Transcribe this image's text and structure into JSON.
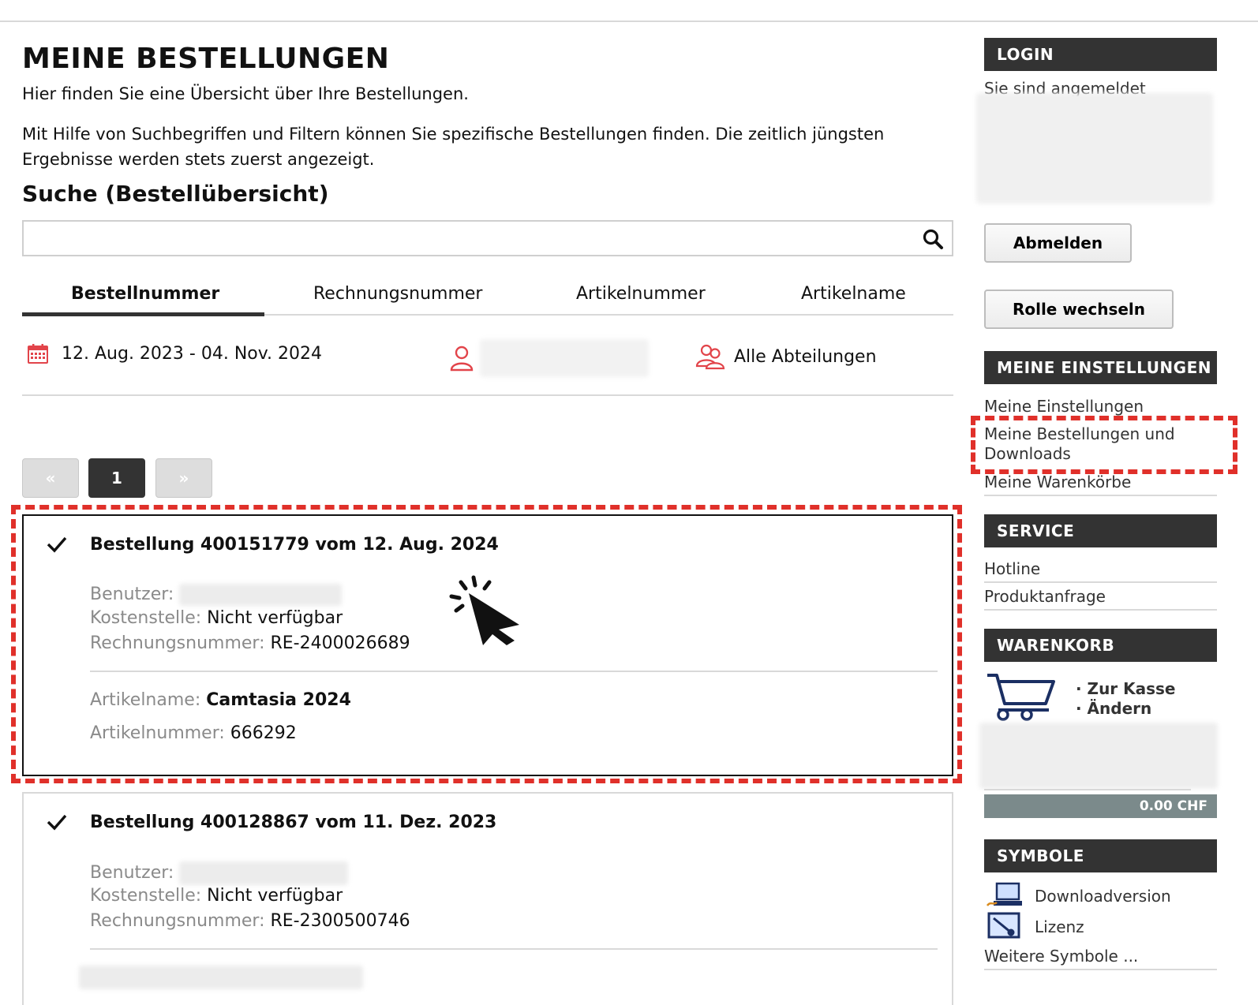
{
  "page": {
    "title": "MEINE BESTELLUNGEN",
    "intro_1": "Hier finden Sie eine Übersicht über Ihre Bestellungen.",
    "intro_2": "Mit Hilfe von Suchbegriffen und Filtern können Sie spezifische Bestellungen finden. Die zeitlich jüngsten Ergebnisse werden stets zuerst angezeigt.",
    "search_title": "Suche (Bestellübersicht)"
  },
  "search": {
    "value": "",
    "placeholder": ""
  },
  "tabs": [
    {
      "label": "Bestellnummer",
      "active": true
    },
    {
      "label": "Rechnungsnummer",
      "active": false
    },
    {
      "label": "Artikelnummer",
      "active": false
    },
    {
      "label": "Artikelname",
      "active": false
    }
  ],
  "filters": {
    "date_range": "12. Aug. 2023 - 04. Nov. 2024",
    "user": "",
    "department": "Alle Abteilungen"
  },
  "pager": {
    "prev": "«",
    "current": "1",
    "next": "»"
  },
  "orders": [
    {
      "title": "Bestellung 400151779 vom 12. Aug. 2024",
      "user_label": "Benutzer:",
      "cost_label": "Kostenstelle:",
      "cost_value": "Nicht verfügbar",
      "invoice_label": "Rechnungsnummer:",
      "invoice_value": "RE-2400026689",
      "article_name_label": "Artikelname:",
      "article_name_value": "Camtasia 2024",
      "article_number_label": "Artikelnummer:",
      "article_number_value": "666292"
    },
    {
      "title": "Bestellung 400128867 vom 11. Dez. 2023",
      "user_label": "Benutzer:",
      "cost_label": "Kostenstelle:",
      "cost_value": "Nicht verfügbar",
      "invoice_label": "Rechnungsnummer:",
      "invoice_value": "RE-2300500746"
    }
  ],
  "sidebar": {
    "login_head": "LOGIN",
    "login_status": "Sie sind angemeldet",
    "logout_button": "Abmelden",
    "switch_role_button": "Rolle wechseln",
    "settings_head": "MEINE EINSTELLUNGEN",
    "settings_links": [
      "Meine Einstellungen",
      "Meine Bestellungen und Downloads",
      "Meine Warenkörbe"
    ],
    "service_head": "SERVICE",
    "service_links": [
      "Hotline",
      "Produktanfrage"
    ],
    "cart_head": "WARENKORB",
    "cart_checkout": "· Zur Kasse",
    "cart_edit": "· Ändern",
    "cart_total": "0.00 CHF",
    "symbols_head": "SYMBOLE",
    "symbol_download": "Downloadversion",
    "symbol_license": "Lizenz",
    "symbols_more": "Weitere Symbole ..."
  },
  "colors": {
    "accent_red": "#e0302a",
    "dark": "#333333",
    "total_bar": "#7b8a8b",
    "cart_blue": "#1b2f63"
  }
}
